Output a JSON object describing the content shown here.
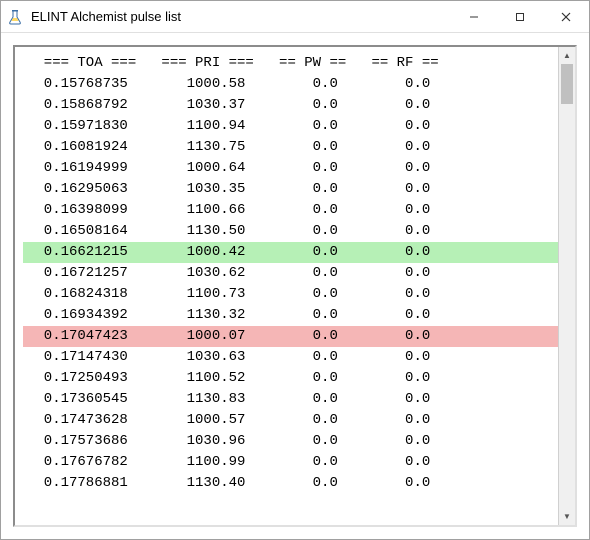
{
  "window": {
    "title": "ELINT Alchemist pulse list"
  },
  "columns": {
    "toa": "=== TOA ===",
    "pri": "=== PRI ===",
    "pw": "== PW ==",
    "rf": "== RF =="
  },
  "rows": [
    {
      "toa": "0.15768735",
      "pri": "1000.58",
      "pw": "0.0",
      "rf": "0.0",
      "hl": ""
    },
    {
      "toa": "0.15868792",
      "pri": "1030.37",
      "pw": "0.0",
      "rf": "0.0",
      "hl": ""
    },
    {
      "toa": "0.15971830",
      "pri": "1100.94",
      "pw": "0.0",
      "rf": "0.0",
      "hl": ""
    },
    {
      "toa": "0.16081924",
      "pri": "1130.75",
      "pw": "0.0",
      "rf": "0.0",
      "hl": ""
    },
    {
      "toa": "0.16194999",
      "pri": "1000.64",
      "pw": "0.0",
      "rf": "0.0",
      "hl": ""
    },
    {
      "toa": "0.16295063",
      "pri": "1030.35",
      "pw": "0.0",
      "rf": "0.0",
      "hl": ""
    },
    {
      "toa": "0.16398099",
      "pri": "1100.66",
      "pw": "0.0",
      "rf": "0.0",
      "hl": ""
    },
    {
      "toa": "0.16508164",
      "pri": "1130.50",
      "pw": "0.0",
      "rf": "0.0",
      "hl": ""
    },
    {
      "toa": "0.16621215",
      "pri": "1000.42",
      "pw": "0.0",
      "rf": "0.0",
      "hl": "green"
    },
    {
      "toa": "0.16721257",
      "pri": "1030.62",
      "pw": "0.0",
      "rf": "0.0",
      "hl": ""
    },
    {
      "toa": "0.16824318",
      "pri": "1100.73",
      "pw": "0.0",
      "rf": "0.0",
      "hl": ""
    },
    {
      "toa": "0.16934392",
      "pri": "1130.32",
      "pw": "0.0",
      "rf": "0.0",
      "hl": ""
    },
    {
      "toa": "0.17047423",
      "pri": "1000.07",
      "pw": "0.0",
      "rf": "0.0",
      "hl": "red"
    },
    {
      "toa": "0.17147430",
      "pri": "1030.63",
      "pw": "0.0",
      "rf": "0.0",
      "hl": ""
    },
    {
      "toa": "0.17250493",
      "pri": "1100.52",
      "pw": "0.0",
      "rf": "0.0",
      "hl": ""
    },
    {
      "toa": "0.17360545",
      "pri": "1130.83",
      "pw": "0.0",
      "rf": "0.0",
      "hl": ""
    },
    {
      "toa": "0.17473628",
      "pri": "1000.57",
      "pw": "0.0",
      "rf": "0.0",
      "hl": ""
    },
    {
      "toa": "0.17573686",
      "pri": "1030.96",
      "pw": "0.0",
      "rf": "0.0",
      "hl": ""
    },
    {
      "toa": "0.17676782",
      "pri": "1100.99",
      "pw": "0.0",
      "rf": "0.0",
      "hl": ""
    },
    {
      "toa": "0.17786881",
      "pri": "1130.40",
      "pw": "0.0",
      "rf": "0.0",
      "hl": ""
    }
  ],
  "scrollbar": {
    "up": "▲",
    "down": "▼"
  }
}
